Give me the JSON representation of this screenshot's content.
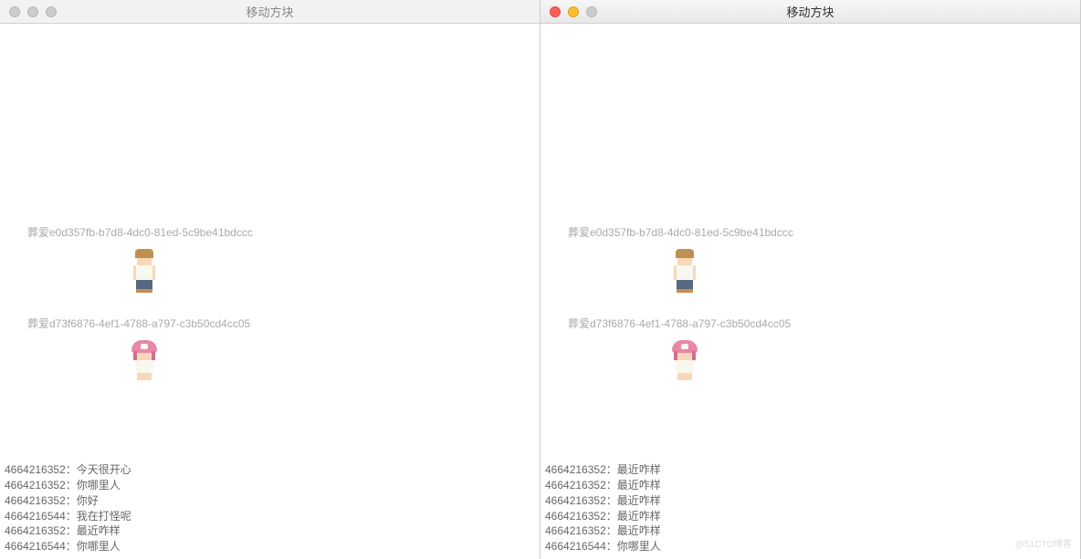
{
  "windows": {
    "left": {
      "title": "移动方块",
      "active": false
    },
    "right": {
      "title": "移动方块",
      "active": true
    }
  },
  "players": {
    "p1": {
      "label": "葬爱e0d357fb-b7d8-4dc0-81ed-5c9be41bdccc"
    },
    "p2": {
      "label": "葬爱d73f6876-4ef1-4788-a797-c3b50cd4cc05"
    }
  },
  "chat": {
    "left": [
      {
        "id": "4664216352",
        "msg": "今天很开心"
      },
      {
        "id": "4664216352",
        "msg": "你哪里人"
      },
      {
        "id": "4664216352",
        "msg": "你好"
      },
      {
        "id": "4664216544",
        "msg": "我在打怪呢"
      },
      {
        "id": "4664216352",
        "msg": "最近咋样"
      },
      {
        "id": "4664216544",
        "msg": "你哪里人"
      }
    ],
    "right": [
      {
        "id": "4664216352",
        "msg": "最近咋样"
      },
      {
        "id": "4664216352",
        "msg": "最近咋样"
      },
      {
        "id": "4664216352",
        "msg": "最近咋样"
      },
      {
        "id": "4664216352",
        "msg": "最近咋样"
      },
      {
        "id": "4664216352",
        "msg": "最近咋样"
      },
      {
        "id": "4664216544",
        "msg": "你哪里人"
      }
    ]
  },
  "watermark": "@51CTO博客"
}
